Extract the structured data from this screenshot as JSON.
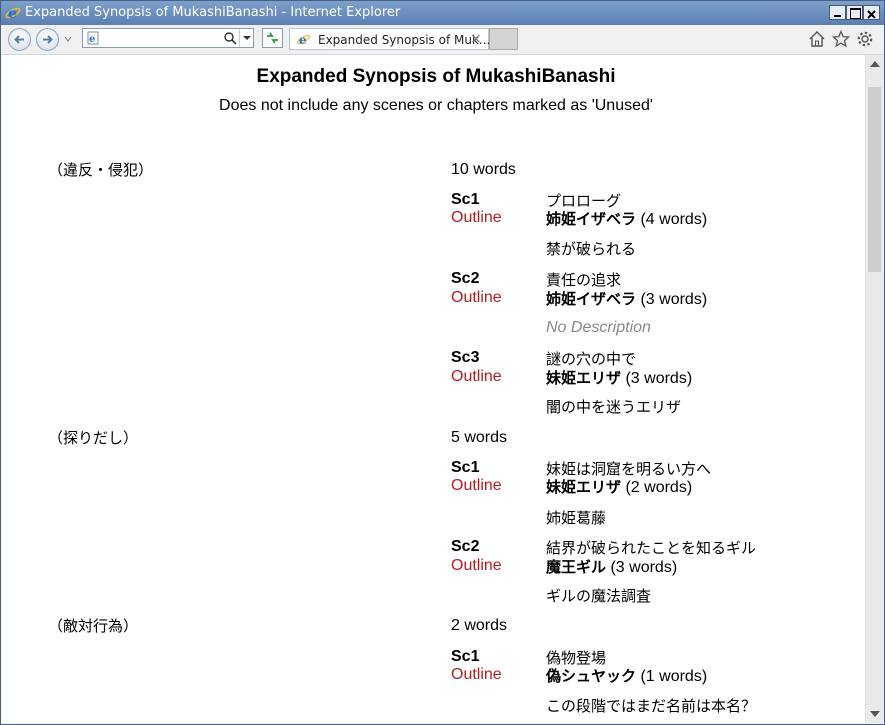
{
  "window": {
    "title": "Expanded Synopsis of MukashiBanashi - Internet Explorer"
  },
  "toolbar": {
    "address_value": "",
    "tab_label": "Expanded Synopsis of Muk...",
    "tab_close": "×"
  },
  "page": {
    "title": "Expanded Synopsis of MukashiBanashi",
    "subtitle": "Does not include any scenes or chapters marked as 'Unused'",
    "chapters": [
      {
        "name": "（違反・侵犯）",
        "words": "10 words",
        "scenes": [
          {
            "id": "Sc1",
            "outline": "Outline",
            "title": "プロローグ",
            "character": "姉姫イザベラ",
            "char_words": " (4 words)",
            "description": "禁が破られる"
          },
          {
            "id": "Sc2",
            "outline": "Outline",
            "title": "責任の追求",
            "character": "姉姫イザベラ",
            "char_words": " (3 words)",
            "description": "No Description"
          },
          {
            "id": "Sc3",
            "outline": "Outline",
            "title": "謎の穴の中で",
            "character": "妹姫エリザ",
            "char_words": " (3 words)",
            "description": "闇の中を迷うエリザ"
          }
        ]
      },
      {
        "name": "（探りだし）",
        "words": "5 words",
        "scenes": [
          {
            "id": "Sc1",
            "outline": "Outline",
            "title": "妹姫は洞窟を明るい方へ",
            "character": "妹姫エリザ",
            "char_words": " (2 words)",
            "description": "姉姫葛藤"
          },
          {
            "id": "Sc2",
            "outline": "Outline",
            "title": "結界が破られたことを知るギル",
            "character": "魔王ギル",
            "char_words": " (3 words)",
            "description": "ギルの魔法調査"
          }
        ]
      },
      {
        "name": "（敵対行為）",
        "words": "2 words",
        "scenes": [
          {
            "id": "Sc1",
            "outline": "Outline",
            "title": "偽物登場",
            "character": "偽シュヤック",
            "char_words": " (1 words)",
            "description": "この段階ではまだ名前は本名？"
          }
        ]
      }
    ]
  }
}
